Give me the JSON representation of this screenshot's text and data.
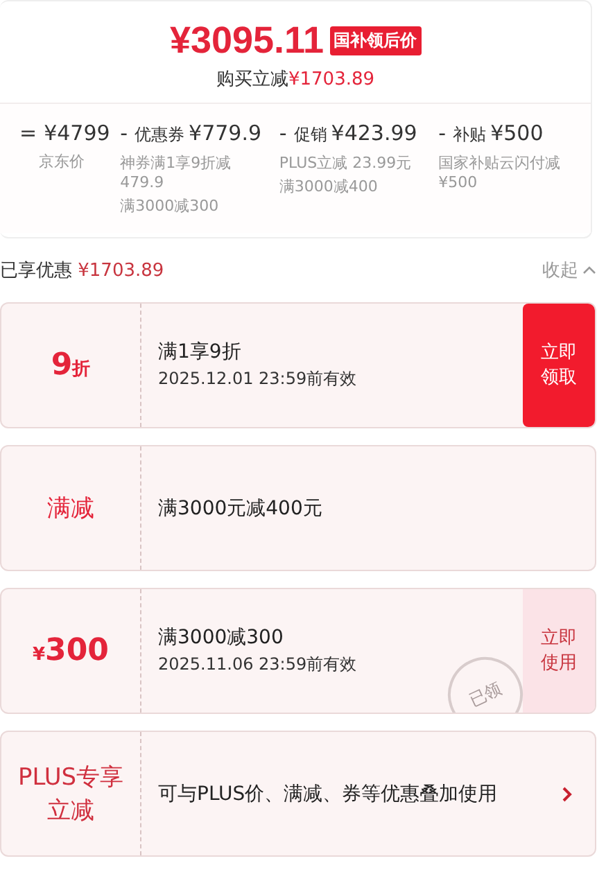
{
  "price": {
    "amount": "¥3095.11",
    "tag": "国补领后价",
    "saving_label": "购买立减",
    "saving_value": "¥1703.89"
  },
  "breakdown": [
    {
      "op": "=",
      "value": "¥4799",
      "notes": [
        "京东价"
      ]
    },
    {
      "op": "-",
      "label": "优惠券",
      "value": "¥779.9",
      "notes": [
        "神券满1享9折减479.9",
        "满3000减300"
      ]
    },
    {
      "op": "-",
      "label": "促销",
      "value": "¥423.99",
      "notes": [
        "PLUS立减 23.99元",
        "满3000减400"
      ]
    },
    {
      "op": "-",
      "label": "补贴",
      "value": "¥500",
      "notes": [
        "国家补贴云闪付减¥500"
      ]
    }
  ],
  "summary": {
    "label": "已享优惠",
    "value": "¥1703.89",
    "toggle": "收起"
  },
  "coupons": [
    {
      "kind": "claim",
      "badge": "9",
      "badge_unit": "折",
      "title": "满1享9折",
      "validity": "2025.12.01 23:59前有效",
      "action": "立即领取"
    },
    {
      "kind": "plain",
      "badge": "满减",
      "title": "满3000元减400元"
    },
    {
      "kind": "claimed",
      "badge_unit": "¥",
      "badge": "300",
      "title": "满3000减300",
      "validity": "2025.11.06 23:59前有效",
      "action": "立即使用",
      "stamp": "已领"
    },
    {
      "kind": "link",
      "badge": "PLUS专享立减",
      "title": "可与PLUS价、满减、券等优惠叠加使用"
    }
  ]
}
